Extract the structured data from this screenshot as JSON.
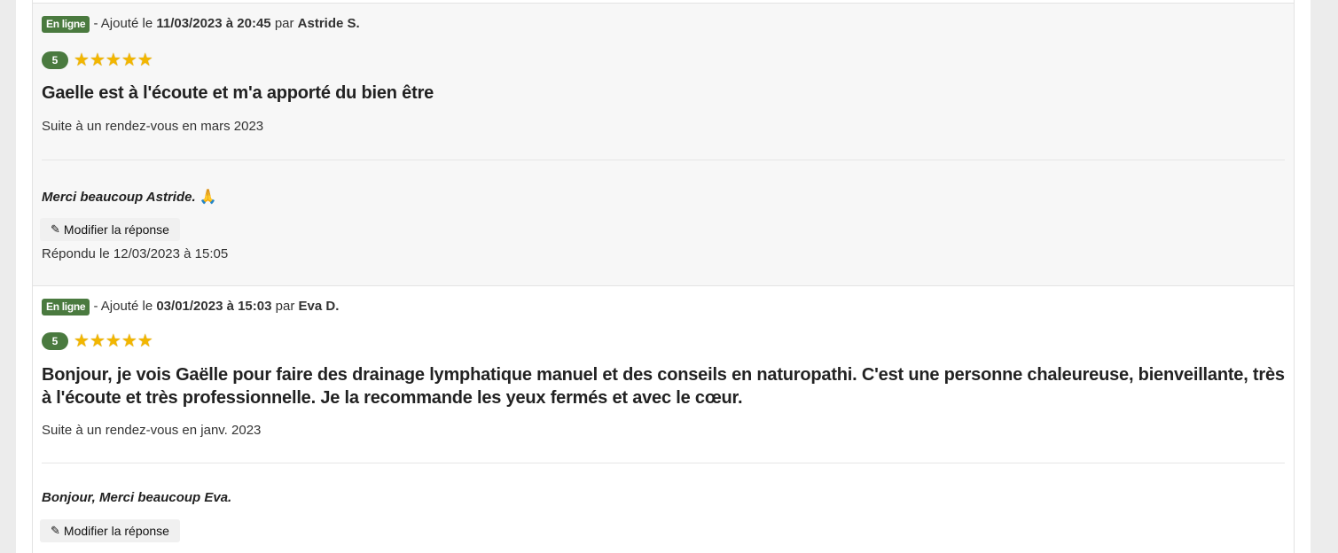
{
  "reviews": [
    {
      "status": "En ligne",
      "added_prefix": "- Ajouté le",
      "date": "11/03/2023 à 20:45",
      "by": "par",
      "author": "Astride S.",
      "score": "5",
      "stars": 5,
      "title": "Gaelle est à l'écoute et m'a apporté du bien être",
      "visit": "Suite à un rendez-vous en mars 2023",
      "reply": "Merci beaucoup Astride.",
      "reply_emoji": "🙏",
      "edit_label": "Modifier la réponse",
      "answered": "Répondu le 12/03/2023 à 15:05"
    },
    {
      "status": "En ligne",
      "added_prefix": "- Ajouté le",
      "date": "03/01/2023 à 15:03",
      "by": "par",
      "author": "Eva D.",
      "score": "5",
      "stars": 5,
      "title": "Bonjour, je vois Gaëlle pour faire des drainage lymphatique manuel et des conseils en naturopathi. C'est une personne chaleureuse, bienveillante, très à l'écoute et très professionnelle. Je la recommande les yeux fermés et avec le cœur.",
      "visit": "Suite à un rendez-vous en janv. 2023",
      "reply": "Bonjour, Merci beaucoup Eva.",
      "edit_label": "Modifier la réponse"
    }
  ],
  "colors": {
    "badge": "#4a7a3f",
    "star": "#f2b600"
  },
  "icons": {
    "star": "star-icon",
    "edit": "edit-icon"
  }
}
